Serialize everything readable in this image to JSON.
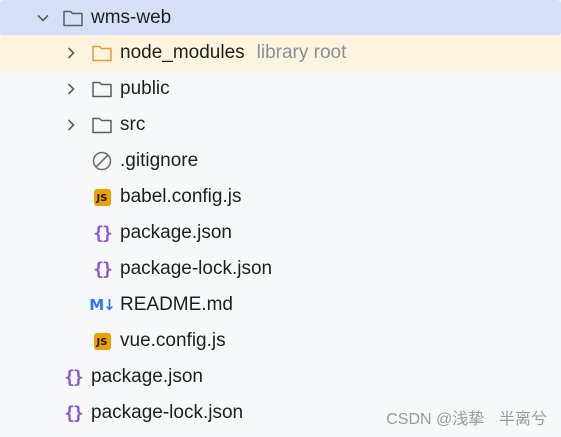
{
  "project_tree": {
    "root": {
      "name": "wms-web",
      "icon": "folder-icon",
      "expanded": true
    },
    "children": [
      {
        "name": "node_modules",
        "hint": "library root",
        "icon": "folder-icon",
        "icon_color": "#e6993e",
        "expandable": true
      },
      {
        "name": "public",
        "icon": "folder-icon",
        "expandable": true
      },
      {
        "name": "src",
        "icon": "folder-icon",
        "expandable": true
      },
      {
        "name": ".gitignore",
        "icon": "ignore-icon"
      },
      {
        "name": "babel.config.js",
        "icon": "js-file-icon",
        "badge": "JS"
      },
      {
        "name": "package.json",
        "icon": "json-file-icon",
        "badge": "{}"
      },
      {
        "name": "package-lock.json",
        "icon": "json-file-icon",
        "badge": "{}"
      },
      {
        "name": "README.md",
        "icon": "markdown-file-icon",
        "badge": "M↓"
      },
      {
        "name": "vue.config.js",
        "icon": "js-file-icon",
        "badge": "JS"
      }
    ],
    "outer_files": [
      {
        "name": "package.json",
        "icon": "json-file-icon",
        "badge": "{}"
      },
      {
        "name": "package-lock.json",
        "icon": "json-file-icon",
        "badge": "{}"
      }
    ]
  },
  "colors": {
    "selected_row": "#d5e0f8",
    "library_root_row": "#fdf4df",
    "js_badge": "#f0a100",
    "json_braces": "#8a56d8",
    "markdown": "#3574f0"
  },
  "watermark": "CSDN @浅挚ㅤ半离兮"
}
